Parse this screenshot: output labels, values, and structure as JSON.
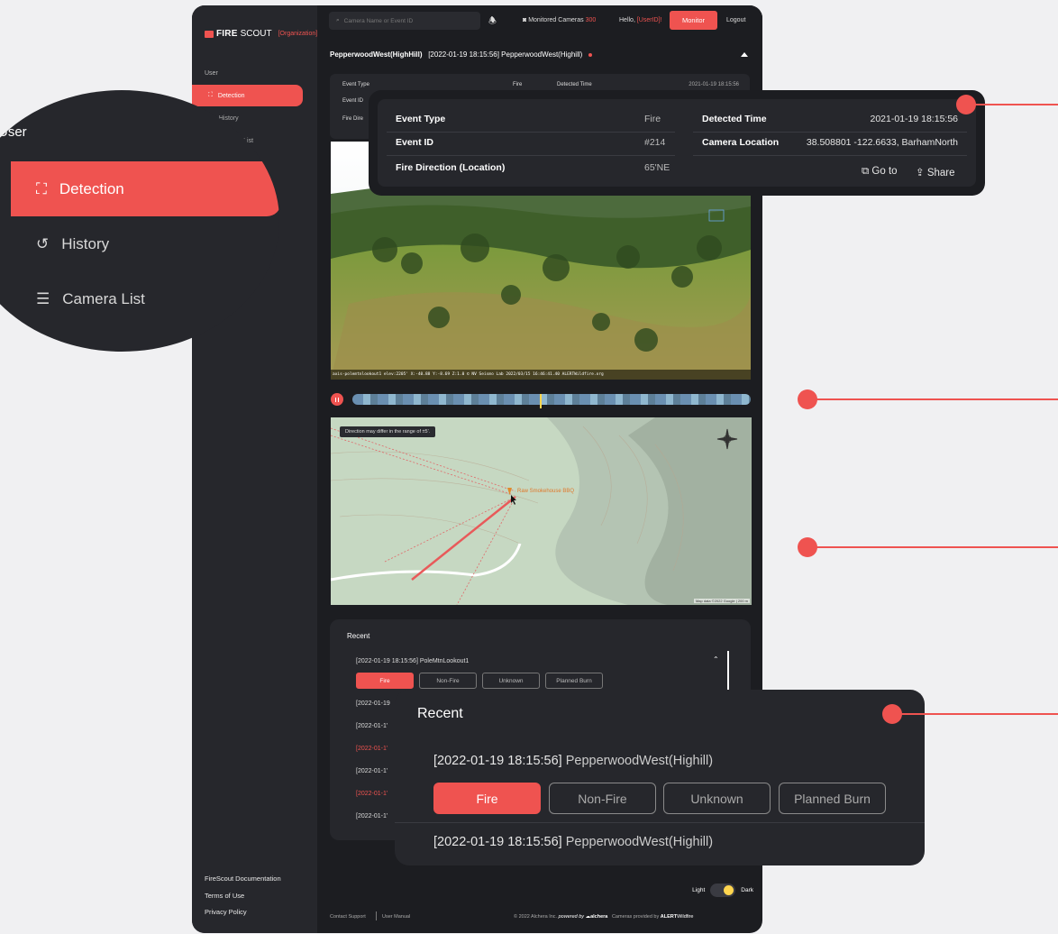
{
  "brand": {
    "fire": "FIRE",
    "scout": "SCOUT",
    "org": "[Organization]"
  },
  "sidebar": {
    "section": "User",
    "items": [
      {
        "label": "Detection",
        "icon": "detection-icon"
      },
      {
        "label": "History",
        "icon": "history-icon"
      },
      {
        "label": "Camera List",
        "icon": "list-icon"
      }
    ],
    "footer": [
      "FireScout Documentation",
      "Terms of Use",
      "Privacy Policy"
    ]
  },
  "topbar": {
    "search_placeholder": "Camera Name or Event ID",
    "monitored_label": "Monitored Cameras",
    "monitored_count": "300",
    "hello": "Hello,",
    "user": "[UserID]!",
    "monitor": "Monitor",
    "logout": "Logout"
  },
  "camera": {
    "name": "PepperwoodWest(HighHill)",
    "stamp": "[2022-01-19 18:15:56]",
    "stamp_name": "PepperwoodWest(Highill)",
    "caption": "axis-polemtnlookout1 elev:2205' X:-40.88 Y:-8.69 Z:1.0  © NV Seismo Lab 2022/03/15 16:46:41.40 ALERTWildfire.org"
  },
  "event": {
    "type_label": "Event Type",
    "type_value": "Fire",
    "id_label": "Event ID",
    "id_value": "#214",
    "direction_label": "Fire Direction (Location)",
    "direction_value": "65'NE",
    "detected_label": "Detected Time",
    "detected_value": "2021-01-19 18:15:56",
    "location_label": "Camera Location",
    "location_value": "38.508801  -122.6633, BarhamNorth",
    "goto": "Go to",
    "share": "Share",
    "small_type": "Event Type",
    "small_fire": "Fire",
    "small_detected": "Detected Time",
    "small_detected_value": "2021-01-19 18:15:56",
    "small_id": "Event ID",
    "small_dir": "Fire Dire"
  },
  "map": {
    "note": "Direction may differ in the range of ±5'.",
    "marker": "Raw Smokehouse BBQ",
    "credit": "Map data ©2022 Google | 200 m"
  },
  "recent": {
    "title": "Recent",
    "first": "[2022-01-19 18:15:56] PoleMtnLookout1",
    "chips": [
      "Fire",
      "Non-Fire",
      "Unknown",
      "Planned Burn"
    ],
    "rows": [
      {
        "text": "[2022-01-19",
        "red": false
      },
      {
        "text": "[2022-01-1'",
        "red": false
      },
      {
        "text": "[2022-01-1'",
        "red": true
      },
      {
        "text": "[2022-01-1'",
        "red": false
      },
      {
        "text": "[2022-01-1'",
        "red": true
      },
      {
        "text": "[2022-01-1'",
        "red": false
      }
    ]
  },
  "zoom_recent": {
    "title": "Recent",
    "stamp": "[2022-01-19 18:15:56]",
    "name": "PepperwoodWest(Highill)",
    "chips": [
      "Fire",
      "Non-Fire",
      "Unknown",
      "Planned Burn"
    ],
    "stamp2": "[2022-01-19 18:15:56]",
    "name2": "PepperwoodWest(Highill)"
  },
  "theme": {
    "light": "Light",
    "dark": "Dark"
  },
  "footer": {
    "contact": "Contact Support",
    "manual": "User Manual",
    "copyright": "© 2022 Alchera Inc.",
    "powered": "powered by",
    "alchera": "alchera",
    "cameras": "Cameras provided by",
    "alert": "ALERT",
    "wildfire": "Wildfire"
  },
  "colors": {
    "accent": "#ef5350",
    "bg": "#1c1d21",
    "panel": "#26272c"
  }
}
